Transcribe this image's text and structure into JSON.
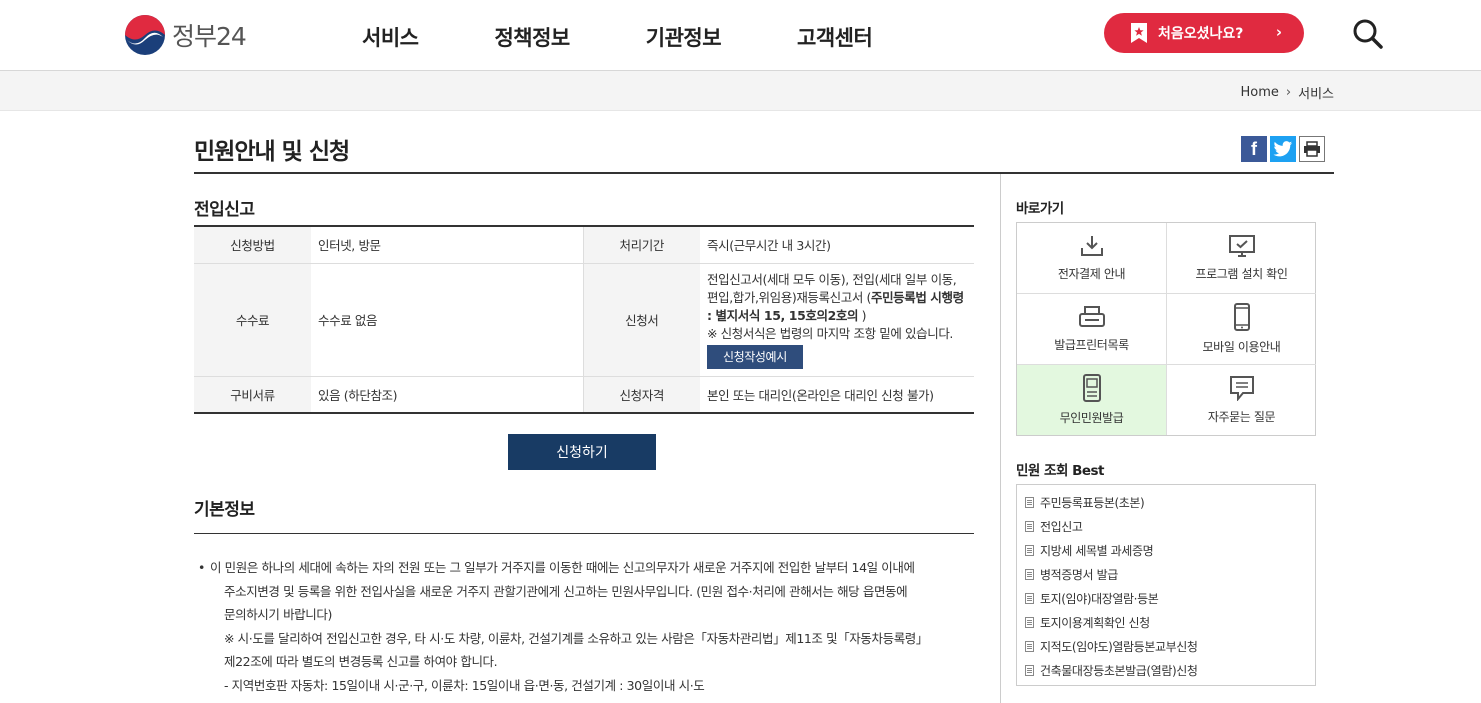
{
  "header": {
    "logo_text": "정부24",
    "nav": [
      "서비스",
      "정책정보",
      "기관정보",
      "고객센터"
    ],
    "first_visit_label": "처음오셨나요?"
  },
  "breadcrumb": {
    "home": "Home",
    "current": "서비스"
  },
  "page_title": "민원안내 및 신청",
  "service": {
    "title": "전입신고",
    "rows": [
      {
        "h1": "신청방법",
        "v1": "인터넷, 방문",
        "h2": "처리기간",
        "v2": "즉시(근무시간 내 3시간)"
      },
      {
        "h1": "수수료",
        "v1": "수수료 없음",
        "h2": "신청서",
        "v2_text": "전입신고서(세대 모두 이동), 전입(세대 일부 이동,편입,합가,위임용)재등록신고서 (",
        "v2_bold": "주민등록법 시행령 : 별지서식 15, 15호의2호의",
        "v2_end": " )",
        "v2_note": "※ 신청서식은 법령의 마지막 조항 밑에 있습니다.",
        "example_button": "신청작성예시"
      },
      {
        "h1": "구비서류",
        "v1": "있음 (하단참조)",
        "h2": "신청자격",
        "v2": "본인 또는 대리인(온라인은 대리인 신청 불가)"
      }
    ],
    "apply_button": "신청하기"
  },
  "basic_info": {
    "title": "기본정보",
    "lines": [
      "이 민원은 하나의 세대에 속하는 자의 전원 또는 그 일부가 거주지를 이동한 때에는 신고의무자가 새로운 거주지에 전입한 날부터 14일 이내에",
      "주소지변경 및 등록을 위한 전입사실을 새로운 거주지 관할기관에게 신고하는 민원사무입니다. (민원 접수·처리에 관해서는 해당 읍면동에",
      "문의하시기 바랍니다)",
      "※ 시·도를 달리하여 전입신고한 경우, 타 시·도 차량, 이륜차, 건설기계를 소유하고 있는 사람은「자동차관리법」제11조 및「자동차등록령」",
      "제22조에 따라 별도의 변경등록 신고를 하여야 합니다.",
      "- 지역번호판 자동차: 15일이내 시·군·구, 이륜차: 15일이내 읍·면·동, 건설기계 : 30일이내 시·도"
    ]
  },
  "quick_links": {
    "title": "바로가기",
    "items": [
      {
        "label": "전자결제 안내",
        "icon": "download-icon"
      },
      {
        "label": "프로그램 설치 확인",
        "icon": "monitor-check-icon"
      },
      {
        "label": "발급프린터목록",
        "icon": "printer-icon"
      },
      {
        "label": "모바일 이용안내",
        "icon": "mobile-icon"
      },
      {
        "label": "무인민원발급",
        "icon": "kiosk-icon"
      },
      {
        "label": "자주묻는 질문",
        "icon": "chat-icon"
      }
    ]
  },
  "best": {
    "title": "민원 조회 Best",
    "items": [
      "주민등록표등본(초본)",
      "전입신고",
      "지방세 세목별 과세증명",
      "병적증명서 발급",
      "토지(임야)대장열람·등본",
      "토지이용계획확인 신청",
      "지적도(임야도)열람등본교부신청",
      "건축물대장등초본발급(열람)신청"
    ]
  },
  "colors": {
    "accent_red": "#e02a40",
    "navy": "#183b64",
    "highlight_green": "#e3f8df"
  }
}
